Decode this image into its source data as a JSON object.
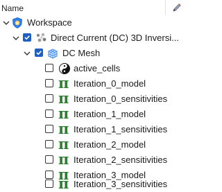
{
  "header": {
    "title": "Name",
    "edit_icon": "pencil-icon"
  },
  "tree": {
    "workspace": {
      "label": "Workspace",
      "icon": "workspace-icon"
    },
    "dc_inversion": {
      "label": "Direct Current (DC) 3D Inversi...",
      "icon": "dc-inversion-icon",
      "checked": true
    },
    "dc_mesh": {
      "label": "DC Mesh",
      "icon": "mesh-icon",
      "checked": true
    },
    "children": [
      {
        "label": "active_cells",
        "icon": "yin-yang-icon",
        "checked": false
      },
      {
        "label": "Iteration_0_model",
        "icon": "pi-icon",
        "checked": false
      },
      {
        "label": "Iteration_0_sensitivities",
        "icon": "pi-icon",
        "checked": false
      },
      {
        "label": "Iteration_1_model",
        "icon": "pi-icon",
        "checked": false
      },
      {
        "label": "Iteration_1_sensitivities",
        "icon": "pi-icon",
        "checked": false
      },
      {
        "label": "Iteration_2_model",
        "icon": "pi-icon",
        "checked": false
      },
      {
        "label": "Iteration_2_sensitivities",
        "icon": "pi-icon",
        "checked": false
      },
      {
        "label": "Iteration_3_model",
        "icon": "pi-icon",
        "checked": false
      },
      {
        "label": "Iteration_3_sensitivities",
        "icon": "pi-icon",
        "checked": false
      }
    ]
  },
  "colors": {
    "accent": "#1f5fbf",
    "pi_green": "#2e7d32"
  }
}
